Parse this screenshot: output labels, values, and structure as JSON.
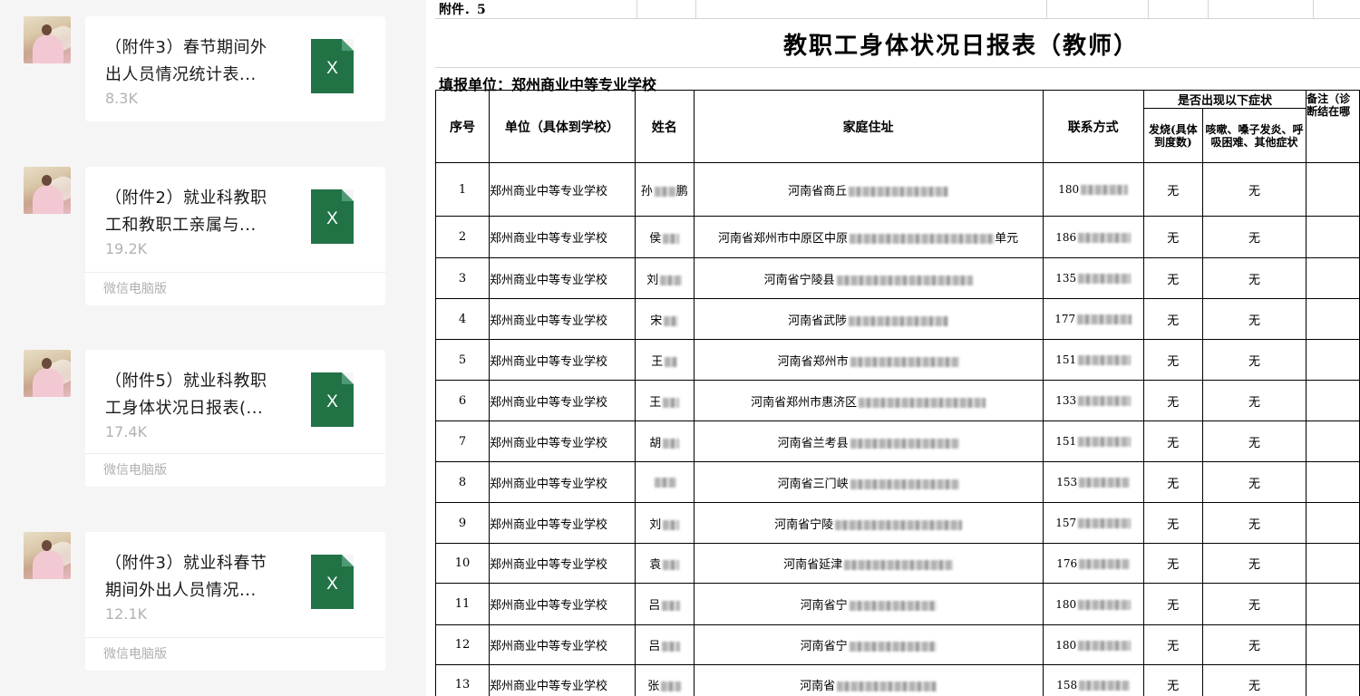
{
  "chat": {
    "messages": [
      {
        "name_line1": "（附件3）春节期间外",
        "name_line2": "出人员情况统计表...",
        "size": "8.3K",
        "footer": ""
      },
      {
        "name_line1": "（附件2）就业科教职",
        "name_line2": "工和教职工亲属与...",
        "size": "19.2K",
        "footer": "微信电脑版"
      },
      {
        "name_line1": "（附件5）就业科教职",
        "name_line2": "工身体状况日报表(...",
        "size": "17.4K",
        "footer": "微信电脑版"
      },
      {
        "name_line1": "（附件3）就业科春节",
        "name_line2": "期间外出人员情况...",
        "size": "12.1K",
        "footer": "微信电脑版"
      }
    ],
    "file_icon_letter": "X",
    "file_icon_color": "#217346"
  },
  "sheet": {
    "attachment_label": "附件．5",
    "title": "教职工身体状况日报表（教师）",
    "reporting_unit": "填报单位：郑州商业中等专业学校",
    "headers": {
      "seq": "序号",
      "unit": "单位（具体到学校）",
      "name": "姓名",
      "address": "家庭住址",
      "contact": "联系方式",
      "symptom_group": "是否出现以下症状",
      "fever": "发烧(具体到度数)",
      "cough": "咳嗽、嗓子发炎、呼吸困难、其他症状",
      "remark": "备注（诊断结在哪"
    },
    "rows": [
      {
        "seq": "1",
        "unit": "郑州商业中等专业学校",
        "name": "孙",
        "name_tail": "鹏",
        "address": "河南省商丘",
        "address_tail": "",
        "contact": "180",
        "fever": "无",
        "cough": "无"
      },
      {
        "seq": "2",
        "unit": "郑州商业中等专业学校",
        "name": "侯",
        "name_tail": "",
        "address": "河南省郑州市中原区中原",
        "address_tail": "单元",
        "contact": "186",
        "fever": "无",
        "cough": "无"
      },
      {
        "seq": "3",
        "unit": "郑州商业中等专业学校",
        "name": "刘",
        "name_tail": "",
        "address": "河南省宁陵县",
        "address_tail": "",
        "contact": "135",
        "fever": "无",
        "cough": "无"
      },
      {
        "seq": "4",
        "unit": "郑州商业中等专业学校",
        "name": "宋",
        "name_tail": "",
        "address": "河南省武陟",
        "address_tail": "",
        "contact": "177",
        "fever": "无",
        "cough": "无"
      },
      {
        "seq": "5",
        "unit": "郑州商业中等专业学校",
        "name": "王",
        "name_tail": "",
        "address": "河南省郑州市",
        "address_tail": "",
        "contact": "151",
        "fever": "无",
        "cough": "无"
      },
      {
        "seq": "6",
        "unit": "郑州商业中等专业学校",
        "name": "王",
        "name_tail": "",
        "address": "河南省郑州市惠济区",
        "address_tail": "",
        "contact": "133",
        "fever": "无",
        "cough": "无"
      },
      {
        "seq": "7",
        "unit": "郑州商业中等专业学校",
        "name": "胡",
        "name_tail": "",
        "address": "河南省兰考县",
        "address_tail": "",
        "contact": "151",
        "fever": "无",
        "cough": "无"
      },
      {
        "seq": "8",
        "unit": "郑州商业中等专业学校",
        "name": "",
        "name_tail": "",
        "address": "河南省三门峡",
        "address_tail": "",
        "contact": "153",
        "fever": "无",
        "cough": "无"
      },
      {
        "seq": "9",
        "unit": "郑州商业中等专业学校",
        "name": "刘",
        "name_tail": "",
        "address": "河南省宁陵",
        "address_tail": "",
        "contact": "157",
        "fever": "无",
        "cough": "无"
      },
      {
        "seq": "10",
        "unit": "郑州商业中等专业学校",
        "name": "袁",
        "name_tail": "",
        "address": "河南省延津",
        "address_tail": "",
        "contact": "176",
        "fever": "无",
        "cough": "无"
      },
      {
        "seq": "11",
        "unit": "郑州商业中等专业学校",
        "name": "吕",
        "name_tail": "",
        "address": "河南省宁",
        "address_tail": "",
        "contact": "180",
        "fever": "无",
        "cough": "无"
      },
      {
        "seq": "12",
        "unit": "郑州商业中等专业学校",
        "name": "吕",
        "name_tail": "",
        "address": "河南省宁",
        "address_tail": "",
        "contact": "180",
        "fever": "无",
        "cough": "无"
      },
      {
        "seq": "13",
        "unit": "郑州商业中等专业学校",
        "name": "张",
        "name_tail": "",
        "address": "河南省",
        "address_tail": "",
        "contact": "158",
        "fever": "无",
        "cough": "无"
      }
    ]
  }
}
